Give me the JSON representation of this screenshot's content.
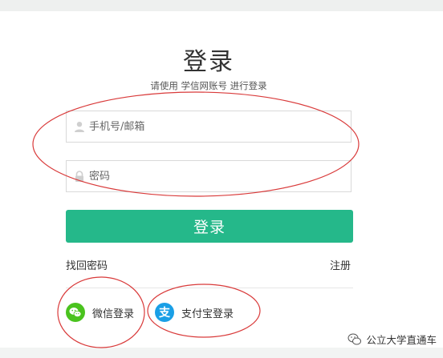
{
  "login": {
    "title": "登录",
    "subtitle": "请使用 学信网账号 进行登录",
    "username_placeholder": "手机号/邮箱",
    "password_placeholder": "密码",
    "login_button": "登录",
    "forgot_password": "找回密码",
    "register": "注册"
  },
  "social": {
    "wechat_label": "微信登录",
    "alipay_label": "支付宝登录",
    "alipay_glyph": "支"
  },
  "watermark": {
    "text": "公立大学直通车"
  },
  "colors": {
    "primary_button": "#25b88a",
    "wechat": "#4ac31e",
    "alipay": "#1a9fe6",
    "annotation_ellipse": "#d93a3a"
  }
}
